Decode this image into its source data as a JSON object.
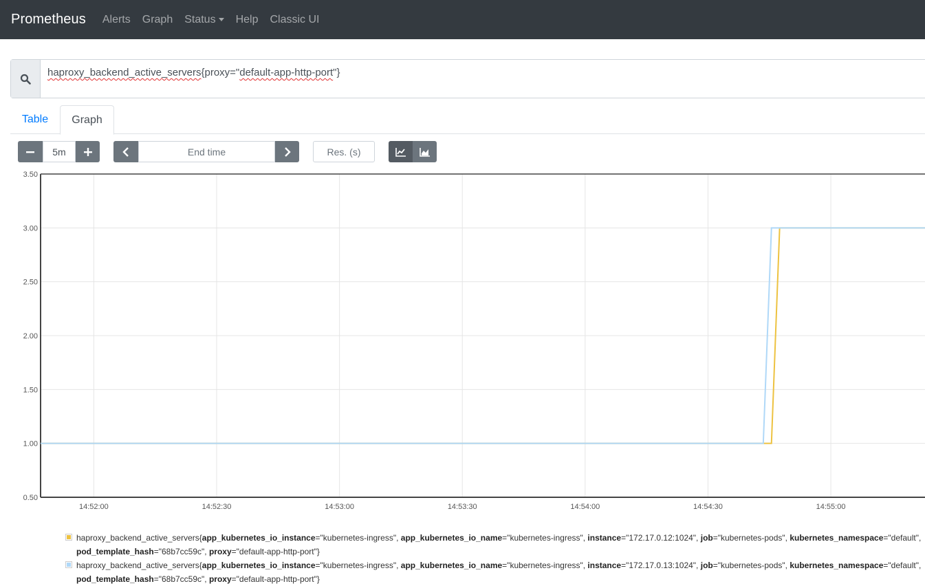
{
  "navbar": {
    "brand": "Prometheus",
    "items": [
      "Alerts",
      "Graph",
      "Status",
      "Help",
      "Classic UI"
    ]
  },
  "expression": {
    "metric": "haproxy_backend_active_servers",
    "open": "{proxy=\"",
    "value": "default-app-http-port",
    "close": "\"}"
  },
  "tabs": {
    "table": "Table",
    "graph": "Graph"
  },
  "controls": {
    "range": "5m",
    "end_time_placeholder": "End time",
    "resolution_placeholder": "Res. (s)"
  },
  "colors": {
    "series_1": "#edc240",
    "series_2": "#afd8f8",
    "navbar_bg": "#343a40",
    "tab_active": "#007bff"
  },
  "chart_data": {
    "type": "line",
    "x_tick_labels": [
      "14:52:00",
      "14:52:30",
      "14:53:00",
      "14:53:30",
      "14:54:00",
      "14:54:30",
      "14:55:00"
    ],
    "y_tick_labels": [
      "3.50",
      "3.00",
      "2.50",
      "2.00",
      "1.50",
      "1.00",
      "0.50"
    ],
    "ylim": [
      0.5,
      3.5
    ],
    "xlim_seconds_from_145200": [
      -13,
      203
    ],
    "grid": true,
    "series": [
      {
        "color": "#edc240",
        "points": [
          [
            -13,
            1
          ],
          [
            165.5,
            1
          ],
          [
            167.5,
            3
          ],
          [
            203,
            3
          ]
        ]
      },
      {
        "color": "#afd8f8",
        "points": [
          [
            -13,
            1
          ],
          [
            163.5,
            1
          ],
          [
            165.5,
            3
          ],
          [
            203,
            3
          ]
        ]
      }
    ]
  },
  "legend": [
    {
      "prefix": "haproxy_backend_active_servers{",
      "k1": "app_kubernetes_io_instance",
      "v1": "=\"kubernetes-ingress\", ",
      "k2": "app_kubernetes_io_name",
      "v2": "=\"kubernetes-ingress\", ",
      "k3": "instance",
      "v3": "=\"172.17.0.12:1024\", ",
      "k4": "job",
      "v4": "=\"kubernetes-pods\", ",
      "k5": "kubernetes_namespace",
      "v5": "=\"default\", ",
      "k6": "pod_template_hash",
      "v6": "=\"68b7cc59c\", ",
      "k7": "proxy",
      "v7": "=\"default-app-http-port\"}"
    },
    {
      "prefix": "haproxy_backend_active_servers{",
      "k1": "app_kubernetes_io_instance",
      "v1": "=\"kubernetes-ingress\", ",
      "k2": "app_kubernetes_io_name",
      "v2": "=\"kubernetes-ingress\", ",
      "k3": "instance",
      "v3": "=\"172.17.0.13:1024\", ",
      "k4": "job",
      "v4": "=\"kubernetes-pods\", ",
      "k5": "kubernetes_namespace",
      "v5": "=\"default\", ",
      "k6": "pod_template_hash",
      "v6": "=\"68b7cc59c\", ",
      "k7": "proxy",
      "v7": "=\"default-app-http-port\"}"
    }
  ]
}
